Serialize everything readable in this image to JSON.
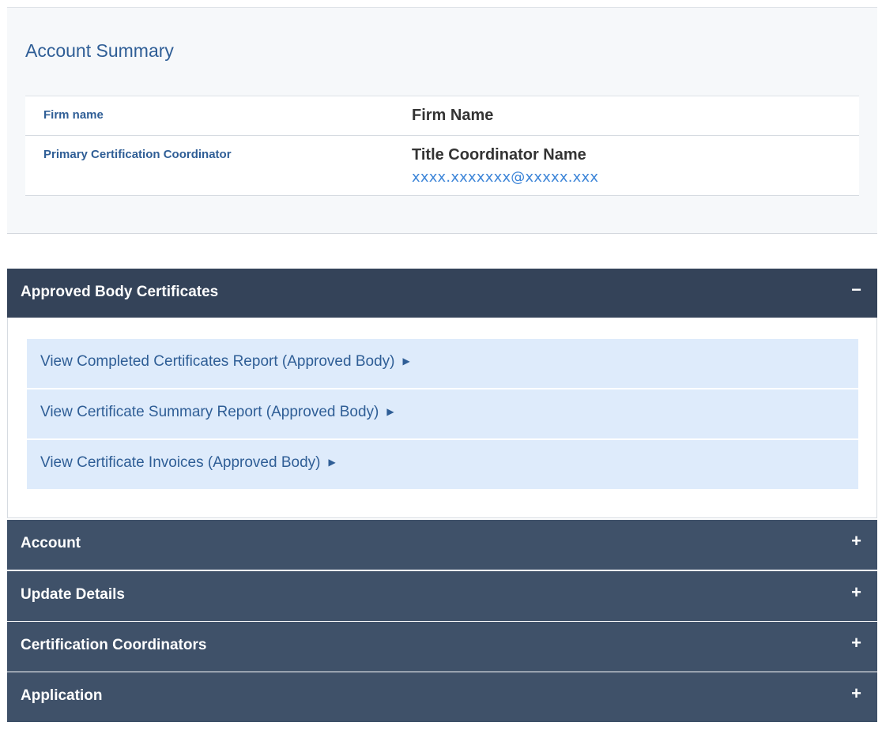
{
  "summary": {
    "title": "Account Summary",
    "rows": [
      {
        "label": "Firm name",
        "value": "Firm Name"
      },
      {
        "label": "Primary Certification Coordinator",
        "value": "Title Coordinator Name",
        "email": "xxxx.xxxxxxx@xxxxx.xxx"
      }
    ]
  },
  "accordion": {
    "approved": {
      "title": "Approved Body Certificates",
      "toggle": "−",
      "links": [
        {
          "label": "View Completed Certificates Report (Approved Body)",
          "arrow": "▶"
        },
        {
          "label": "View Certificate Summary Report (Approved Body)",
          "arrow": "▶"
        },
        {
          "label": "View Certificate Invoices (Approved Body)",
          "arrow": "▶"
        }
      ]
    },
    "account": {
      "title": "Account",
      "toggle": "+"
    },
    "update": {
      "title": "Update Details",
      "toggle": "+"
    },
    "coordinators": {
      "title": "Certification Coordinators",
      "toggle": "+"
    },
    "application": {
      "title": "Application",
      "toggle": "+"
    }
  }
}
